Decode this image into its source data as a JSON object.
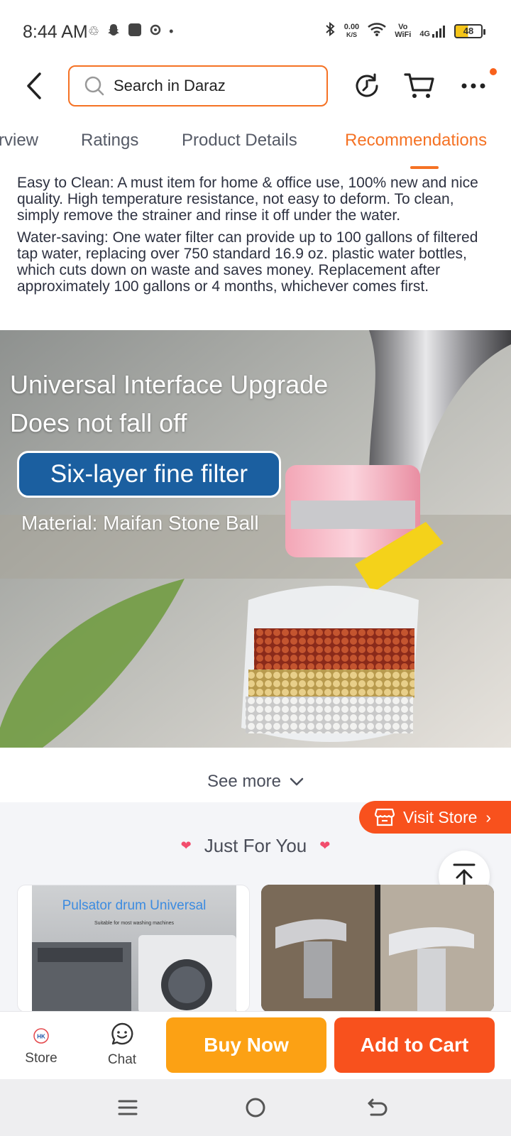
{
  "status_bar": {
    "time": "8:44 AM",
    "net_speed_value": "0.00",
    "net_speed_unit": "K/S",
    "vowifi_top": "Vo",
    "vowifi_bottom": "WiFi",
    "network": "4G",
    "battery": "48"
  },
  "header": {
    "search_placeholder": "Search in Daraz",
    "accent_color": "#f57224"
  },
  "tabs": [
    {
      "label": "rview"
    },
    {
      "label": "Ratings"
    },
    {
      "label": "Product Details"
    },
    {
      "label": "Recommendations",
      "active": true
    }
  ],
  "description": [
    "Easy to Clean: A must item for home & office use, 100% new and nice quality. High temperature resistance, not easy to deform. To clean, simply remove the strainer and rinse it off under the water.",
    "Water-saving: One water filter can provide up to 100 gallons of filtered tap water, replacing over 750 standard 16.9 oz. plastic water bottles, which cuts down on waste and saves money. Replacement after approximately 100 gallons or 4 months, whichever comes first."
  ],
  "product_image": {
    "line1": "Universal Interface Upgrade",
    "line2": "Does not fall off",
    "pill": "Six-layer fine filter",
    "material": "Material: Maifan Stone Ball"
  },
  "see_more": "See more",
  "visit_store": "Visit Store",
  "just_for_you": "Just For You",
  "recommendations": [
    {
      "title": "Pulsator drum Universal",
      "subtitle": "Suitable for most washing machines"
    },
    {
      "title": "",
      "subtitle": ""
    }
  ],
  "action_bar": {
    "store_label": "Store",
    "store_badge": "HK",
    "chat_label": "Chat",
    "buy_now": "Buy Now",
    "add_to_cart": "Add to Cart",
    "buy_color": "#fca114",
    "cart_color": "#f8511d"
  }
}
